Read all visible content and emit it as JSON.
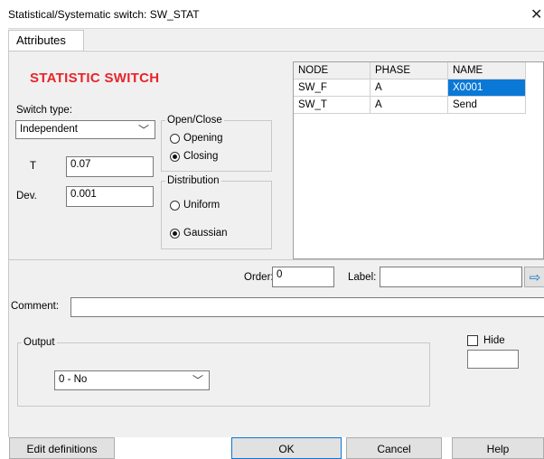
{
  "window": {
    "title": "Statistical/Systematic switch: SW_STAT",
    "close_glyph": "✕"
  },
  "tabs": [
    {
      "label": "Attributes"
    }
  ],
  "left": {
    "heading": "STATISTIC SWITCH",
    "switch_type_label": "Switch type:",
    "switch_type_value": "Independent",
    "t_label": "T",
    "t_value": "0.07",
    "dev_label": "Dev.",
    "dev_value": "0.001"
  },
  "open_close": {
    "legend": "Open/Close",
    "opening_label": "Opening",
    "closing_label": "Closing",
    "selected": "Closing"
  },
  "distribution": {
    "legend": "Distribution",
    "uniform_label": "Uniform",
    "gaussian_label": "Gaussian",
    "selected": "Gaussian"
  },
  "node_table": {
    "headers": [
      "NODE",
      "PHASE",
      "NAME"
    ],
    "rows": [
      {
        "node": "SW_F",
        "phase": "A",
        "name": "X0001"
      },
      {
        "node": "SW_T",
        "phase": "A",
        "name": "Send"
      }
    ],
    "selected_cell": "X0001"
  },
  "order": {
    "label": "Order:",
    "value": "0"
  },
  "label_field": {
    "label": "Label:",
    "value": ""
  },
  "comment": {
    "label": "Comment:",
    "value": ""
  },
  "output": {
    "legend": "Output",
    "value": "0 - No"
  },
  "hide": {
    "label": "Hide",
    "checked": false,
    "value": ""
  },
  "buttons": {
    "edit": "Edit definitions",
    "ok": "OK",
    "cancel": "Cancel",
    "help": "Help"
  },
  "colors": {
    "heading": "#e8242a",
    "selection": "#0a78d7",
    "arrow": "#1a74c8"
  }
}
